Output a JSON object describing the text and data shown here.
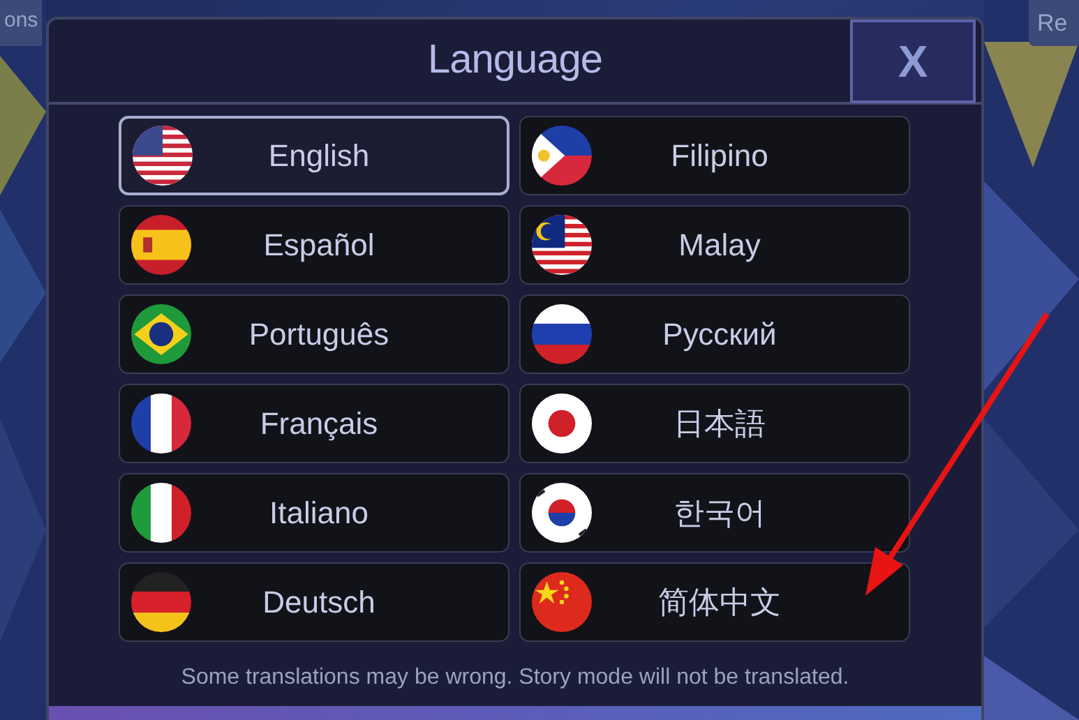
{
  "background_labels": [
    {
      "text": "ons"
    },
    {
      "text": "Re"
    }
  ],
  "dialog": {
    "title": "Language",
    "close": "X"
  },
  "languages": [
    {
      "label": "English",
      "kind": "us",
      "selected": true
    },
    {
      "label": "Filipino",
      "kind": "ph",
      "selected": false
    },
    {
      "label": "Español",
      "kind": "es",
      "selected": false
    },
    {
      "label": "Malay",
      "kind": "my",
      "selected": false
    },
    {
      "label": "Português",
      "kind": "br",
      "selected": false
    },
    {
      "label": "Русский",
      "kind": "ru",
      "selected": false
    },
    {
      "label": "Français",
      "kind": "fr",
      "selected": false
    },
    {
      "label": "日本語",
      "kind": "jp",
      "selected": false
    },
    {
      "label": "Italiano",
      "kind": "it",
      "selected": false
    },
    {
      "label": "한국어",
      "kind": "kr",
      "selected": false
    },
    {
      "label": "Deutsch",
      "kind": "de",
      "selected": false
    },
    {
      "label": "简体中文",
      "kind": "cn",
      "selected": false
    }
  ],
  "note": "Some translations may be wrong. Story mode will not be translated.",
  "annotations": [
    {
      "kind": "arrow"
    }
  ]
}
